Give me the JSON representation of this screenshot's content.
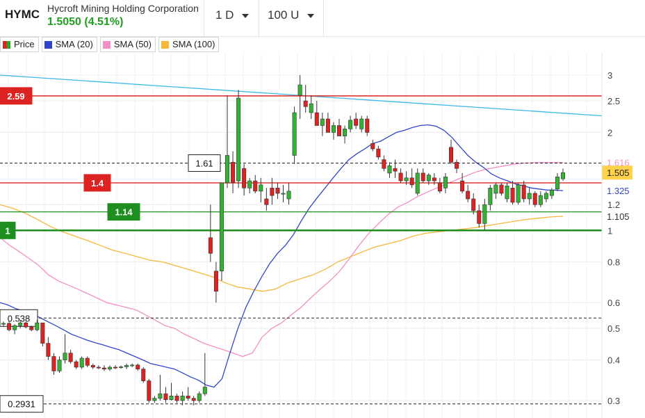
{
  "header": {
    "ticker": "HYMC",
    "company": "Hycroft Mining Holding Corporation",
    "price_text": "1.5050 (4.51%)",
    "interval": "1 D",
    "range": "100 U"
  },
  "legend": [
    {
      "label": "Price",
      "color": "#2aa52a"
    },
    {
      "label": "SMA (20)",
      "color": "#3344cc"
    },
    {
      "label": "SMA (50)",
      "color": "#f28fc4"
    },
    {
      "label": "SMA (100)",
      "color": "#f5b83a"
    }
  ],
  "colors": {
    "up": "#34b234",
    "down": "#dd2222",
    "sma20": "#3344cc",
    "sma50": "#f28fc4",
    "sma100": "#f5b83a",
    "trend": "#3ab8e8",
    "resist_red": "#dd2222",
    "support_green": "#1e8f1e"
  },
  "chart_data": {
    "type": "candlestick",
    "y_scale": "log",
    "ylim": [
      0.28,
      3.15
    ],
    "y_ticks": [
      "3",
      "2.5",
      "2",
      "1.2",
      "1",
      "0.8",
      "0.6",
      "0.5",
      "0.4",
      "0.3"
    ],
    "candles": [
      [
        0.515,
        0.525,
        0.505,
        0.518
      ],
      [
        0.518,
        0.528,
        0.49,
        0.495
      ],
      [
        0.495,
        0.515,
        0.48,
        0.51
      ],
      [
        0.51,
        0.53,
        0.5,
        0.52
      ],
      [
        0.52,
        0.525,
        0.5,
        0.505
      ],
      [
        0.505,
        0.51,
        0.49,
        0.495
      ],
      [
        0.495,
        0.53,
        0.49,
        0.52
      ],
      [
        0.52,
        0.52,
        0.44,
        0.45
      ],
      [
        0.45,
        0.47,
        0.4,
        0.41
      ],
      [
        0.41,
        0.42,
        0.36,
        0.37
      ],
      [
        0.37,
        0.41,
        0.365,
        0.4
      ],
      [
        0.4,
        0.48,
        0.39,
        0.42
      ],
      [
        0.42,
        0.43,
        0.39,
        0.395
      ],
      [
        0.395,
        0.4,
        0.375,
        0.38
      ],
      [
        0.38,
        0.41,
        0.375,
        0.405
      ],
      [
        0.405,
        0.41,
        0.38,
        0.385
      ],
      [
        0.385,
        0.39,
        0.375,
        0.38
      ],
      [
        0.38,
        0.385,
        0.375,
        0.378
      ],
      [
        0.378,
        0.385,
        0.37,
        0.375
      ],
      [
        0.375,
        0.385,
        0.37,
        0.38
      ],
      [
        0.38,
        0.385,
        0.375,
        0.379
      ],
      [
        0.379,
        0.384,
        0.376,
        0.381
      ],
      [
        0.381,
        0.39,
        0.375,
        0.385
      ],
      [
        0.385,
        0.39,
        0.38,
        0.386
      ],
      [
        0.386,
        0.39,
        0.37,
        0.375
      ],
      [
        0.375,
        0.38,
        0.34,
        0.345
      ],
      [
        0.345,
        0.35,
        0.295,
        0.3
      ],
      [
        0.3,
        0.31,
        0.295,
        0.305
      ],
      [
        0.305,
        0.36,
        0.3,
        0.315
      ],
      [
        0.315,
        0.33,
        0.295,
        0.302
      ],
      [
        0.302,
        0.34,
        0.3,
        0.31
      ],
      [
        0.31,
        0.315,
        0.295,
        0.3
      ],
      [
        0.3,
        0.32,
        0.29,
        0.31
      ],
      [
        0.31,
        0.33,
        0.3,
        0.305
      ],
      [
        0.305,
        0.31,
        0.29,
        0.3
      ],
      [
        0.3,
        0.32,
        0.295,
        0.315
      ],
      [
        0.315,
        0.42,
        0.31,
        0.33
      ],
      [
        0.95,
        1.2,
        0.8,
        0.85
      ],
      [
        0.75,
        0.8,
        0.6,
        0.65
      ],
      [
        0.75,
        1.4,
        0.7,
        1.4
      ],
      [
        1.4,
        2.6,
        1.35,
        1.7
      ],
      [
        1.62,
        1.75,
        1.3,
        1.4
      ],
      [
        1.42,
        2.7,
        1.35,
        2.55
      ],
      [
        1.55,
        1.6,
        1.28,
        1.35
      ],
      [
        1.35,
        1.45,
        1.3,
        1.42
      ],
      [
        1.42,
        1.48,
        1.3,
        1.32
      ],
      [
        1.32,
        1.45,
        1.22,
        1.38
      ],
      [
        1.25,
        1.35,
        1.15,
        1.2
      ],
      [
        1.35,
        1.45,
        1.2,
        1.28
      ],
      [
        1.35,
        1.4,
        1.25,
        1.3
      ],
      [
        1.3,
        1.38,
        1.22,
        1.3
      ],
      [
        1.25,
        1.4,
        1.2,
        1.32
      ],
      [
        1.7,
        2.4,
        1.6,
        2.3
      ],
      [
        2.6,
        3.0,
        2.2,
        2.8
      ],
      [
        2.5,
        2.8,
        2.3,
        2.4
      ],
      [
        2.3,
        2.6,
        2.2,
        2.45
      ],
      [
        2.3,
        2.5,
        2.1,
        2.1
      ],
      [
        2.1,
        2.3,
        1.95,
        2.2
      ],
      [
        2.2,
        2.3,
        2.0,
        2.0
      ],
      [
        2.0,
        2.15,
        1.9,
        2.1
      ],
      [
        2.1,
        2.2,
        1.95,
        1.95
      ],
      [
        1.95,
        2.1,
        1.85,
        2.05
      ],
      [
        2.05,
        2.25,
        2.0,
        2.18
      ],
      [
        2.2,
        2.3,
        2.05,
        2.1
      ],
      [
        2.05,
        2.25,
        2.0,
        2.2
      ],
      [
        2.2,
        2.25,
        1.95,
        2.0
      ],
      [
        1.85,
        1.9,
        1.75,
        1.78
      ],
      [
        1.78,
        1.82,
        1.65,
        1.68
      ],
      [
        1.65,
        1.7,
        1.52,
        1.55
      ],
      [
        1.5,
        1.62,
        1.45,
        1.58
      ],
      [
        1.55,
        1.65,
        1.45,
        1.52
      ],
      [
        1.5,
        1.55,
        1.4,
        1.42
      ],
      [
        1.42,
        1.52,
        1.38,
        1.45
      ],
      [
        1.45,
        1.55,
        1.35,
        1.38
      ],
      [
        1.3,
        1.55,
        1.28,
        1.5
      ],
      [
        1.5,
        1.55,
        1.4,
        1.42
      ],
      [
        1.42,
        1.5,
        1.38,
        1.48
      ],
      [
        1.45,
        1.5,
        1.38,
        1.42
      ],
      [
        1.4,
        1.45,
        1.3,
        1.32
      ],
      [
        1.35,
        1.5,
        1.3,
        1.46
      ],
      [
        1.8,
        1.9,
        1.6,
        1.62
      ],
      [
        1.62,
        1.65,
        1.5,
        1.55
      ],
      [
        1.42,
        1.5,
        1.3,
        1.32
      ],
      [
        1.32,
        1.38,
        1.22,
        1.25
      ],
      [
        1.25,
        1.3,
        1.12,
        1.15
      ],
      [
        1.15,
        1.2,
        1.02,
        1.05
      ],
      [
        1.05,
        1.25,
        1.0,
        1.2
      ],
      [
        1.2,
        1.38,
        1.15,
        1.35
      ],
      [
        1.3,
        1.4,
        1.25,
        1.38
      ],
      [
        1.38,
        1.4,
        1.28,
        1.3
      ],
      [
        1.25,
        1.4,
        1.22,
        1.37
      ],
      [
        1.35,
        1.42,
        1.2,
        1.22
      ],
      [
        1.22,
        1.4,
        1.2,
        1.38
      ],
      [
        1.38,
        1.42,
        1.22,
        1.25
      ],
      [
        1.25,
        1.35,
        1.2,
        1.3
      ],
      [
        1.3,
        1.32,
        1.18,
        1.2
      ],
      [
        1.2,
        1.32,
        1.18,
        1.28
      ],
      [
        1.25,
        1.32,
        1.22,
        1.3
      ],
      [
        1.28,
        1.35,
        1.25,
        1.33
      ],
      [
        1.34,
        1.5,
        1.32,
        1.46
      ],
      [
        1.44,
        1.55,
        1.42,
        1.505
      ]
    ],
    "sma20": [
      0.6,
      0.59,
      0.575,
      0.565,
      0.555,
      0.54,
      0.525,
      0.51,
      0.495,
      0.48,
      0.47,
      0.46,
      0.452,
      0.445,
      0.437,
      0.43,
      0.42,
      0.41,
      0.4,
      0.39,
      0.385,
      0.38,
      0.375,
      0.365,
      0.355,
      0.347,
      0.335,
      0.33,
      0.35,
      0.42,
      0.5,
      0.58,
      0.65,
      0.72,
      0.79,
      0.85,
      0.9,
      0.97,
      1.07,
      1.17,
      1.26,
      1.35,
      1.45,
      1.55,
      1.65,
      1.72,
      1.78,
      1.85,
      1.88,
      1.94,
      2.0,
      2.03,
      2.07,
      2.1,
      2.11,
      2.09,
      2.03,
      1.93,
      1.81,
      1.7,
      1.62,
      1.56,
      1.49,
      1.45,
      1.42,
      1.39,
      1.37,
      1.35,
      1.34,
      1.33,
      1.33,
      1.325
    ],
    "sma50": [
      0.95,
      0.9,
      0.86,
      0.82,
      0.78,
      0.73,
      0.7,
      0.68,
      0.66,
      0.64,
      0.62,
      0.6,
      0.59,
      0.58,
      0.57,
      0.55,
      0.53,
      0.51,
      0.5,
      0.48,
      0.465,
      0.45,
      0.44,
      0.43,
      0.42,
      0.41,
      0.42,
      0.47,
      0.5,
      0.52,
      0.55,
      0.58,
      0.62,
      0.66,
      0.7,
      0.75,
      0.82,
      0.9,
      0.98,
      1.05,
      1.12,
      1.18,
      1.22,
      1.27,
      1.31,
      1.35,
      1.39,
      1.43,
      1.47,
      1.51,
      1.54,
      1.56,
      1.58,
      1.6,
      1.61,
      1.615,
      1.616,
      1.616,
      1.616
    ],
    "sma100": [
      1.2,
      1.17,
      1.13,
      1.08,
      1.03,
      0.99,
      0.96,
      0.93,
      0.9,
      0.87,
      0.85,
      0.83,
      0.81,
      0.8,
      0.78,
      0.76,
      0.74,
      0.72,
      0.69,
      0.67,
      0.66,
      0.65,
      0.66,
      0.69,
      0.71,
      0.73,
      0.76,
      0.8,
      0.83,
      0.86,
      0.89,
      0.91,
      0.93,
      0.96,
      0.98,
      0.99,
      1.0,
      1.01,
      1.02,
      1.035,
      1.05,
      1.065,
      1.08,
      1.09,
      1.1,
      1.105
    ],
    "trendline": [
      [
        0,
        3.0
      ],
      [
        1,
        2.25
      ]
    ],
    "levels": [
      {
        "value": 2.59,
        "label": "2.59",
        "style": "solid-red",
        "lx": 0
      },
      {
        "value": 1.4,
        "label": "1.4",
        "style": "solid-red",
        "lx": 121
      },
      {
        "value": 1.14,
        "label": "1.14",
        "style": "solid-green",
        "lx": 155
      },
      {
        "value": 1.0,
        "label": "1",
        "style": "solid-green-thick",
        "lx": 0
      },
      {
        "value": 1.61,
        "label": "1.61",
        "style": "dashed",
        "lx": 271
      },
      {
        "value": 0.538,
        "label": "0.538",
        "style": "dashed",
        "lx": 0
      },
      {
        "value": 0.2931,
        "label": "0.2931",
        "style": "dashed",
        "lx": 0
      }
    ],
    "right_labels": [
      {
        "value": 1.616,
        "text": "1.616",
        "color": "#f28fc4"
      },
      {
        "value": 1.505,
        "text": "1.505",
        "color": "#222",
        "bg": "#ffd24a"
      },
      {
        "value": 1.325,
        "text": "1.325",
        "color": "#3344cc"
      },
      {
        "value": 1.105,
        "text": "1.105",
        "color": "#333"
      }
    ]
  }
}
